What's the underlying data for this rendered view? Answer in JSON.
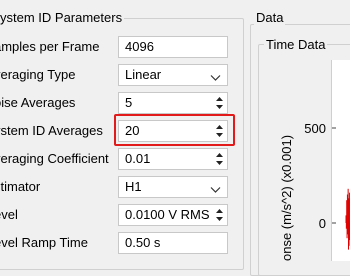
{
  "left_panel": {
    "title": "ystem ID Parameters",
    "rows": [
      {
        "label": "amples per Frame",
        "value": "4096",
        "kind": "text"
      },
      {
        "label": "veraging Type",
        "value": "Linear",
        "kind": "combo"
      },
      {
        "label": "oise Averages",
        "value": "5",
        "kind": "spin"
      },
      {
        "label": "ystem ID Averages",
        "value": "20",
        "kind": "spin",
        "highlighted": true
      },
      {
        "label": "veraging Coefficient",
        "value": "0.01",
        "kind": "spin"
      },
      {
        "label": "stimator",
        "value": "H1",
        "kind": "combo"
      },
      {
        "label": "evel",
        "value": "0.0100 V RMS",
        "kind": "spin"
      },
      {
        "label": "evel Ramp Time",
        "value": "0.50 s",
        "kind": "text"
      }
    ]
  },
  "data_panel": {
    "title": "Data",
    "time_data": {
      "title": "Time Data",
      "ylabel": "onse (m/s^2) (x0.001)",
      "y_ticks": [
        "500",
        "0"
      ]
    }
  },
  "colors": {
    "highlight": "#e21a1a",
    "signal": "#e00000",
    "background": "#f0f0f0"
  },
  "chart_data": {
    "type": "line",
    "title": "Time Data",
    "ylabel": "onse (m/s^2) (x0.001)",
    "y_ticks": [
      500,
      0
    ],
    "series": [
      {
        "values": [
          40,
          -30,
          120,
          -80,
          150,
          -60,
          180,
          -140,
          130,
          -90,
          160,
          -120,
          110,
          -70,
          140
        ]
      }
    ]
  }
}
